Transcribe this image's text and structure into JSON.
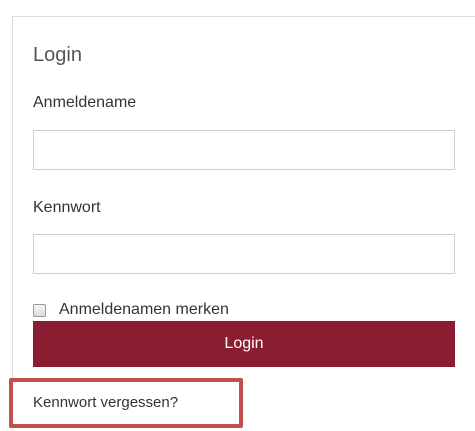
{
  "login_panel": {
    "title": "Login",
    "username": {
      "label": "Anmeldename",
      "value": "",
      "placeholder": ""
    },
    "password": {
      "label": "Kennwort",
      "value": "",
      "placeholder": ""
    },
    "remember": {
      "label": "Anmeldenamen merken",
      "checked": false
    },
    "submit_label": "Login",
    "forgot_password_link": "Kennwort vergessen?"
  },
  "colors": {
    "button_background": "#8a1d32",
    "button_text": "#ffffff",
    "highlight_border": "#c0504d",
    "input_border": "#cfcfcf"
  }
}
